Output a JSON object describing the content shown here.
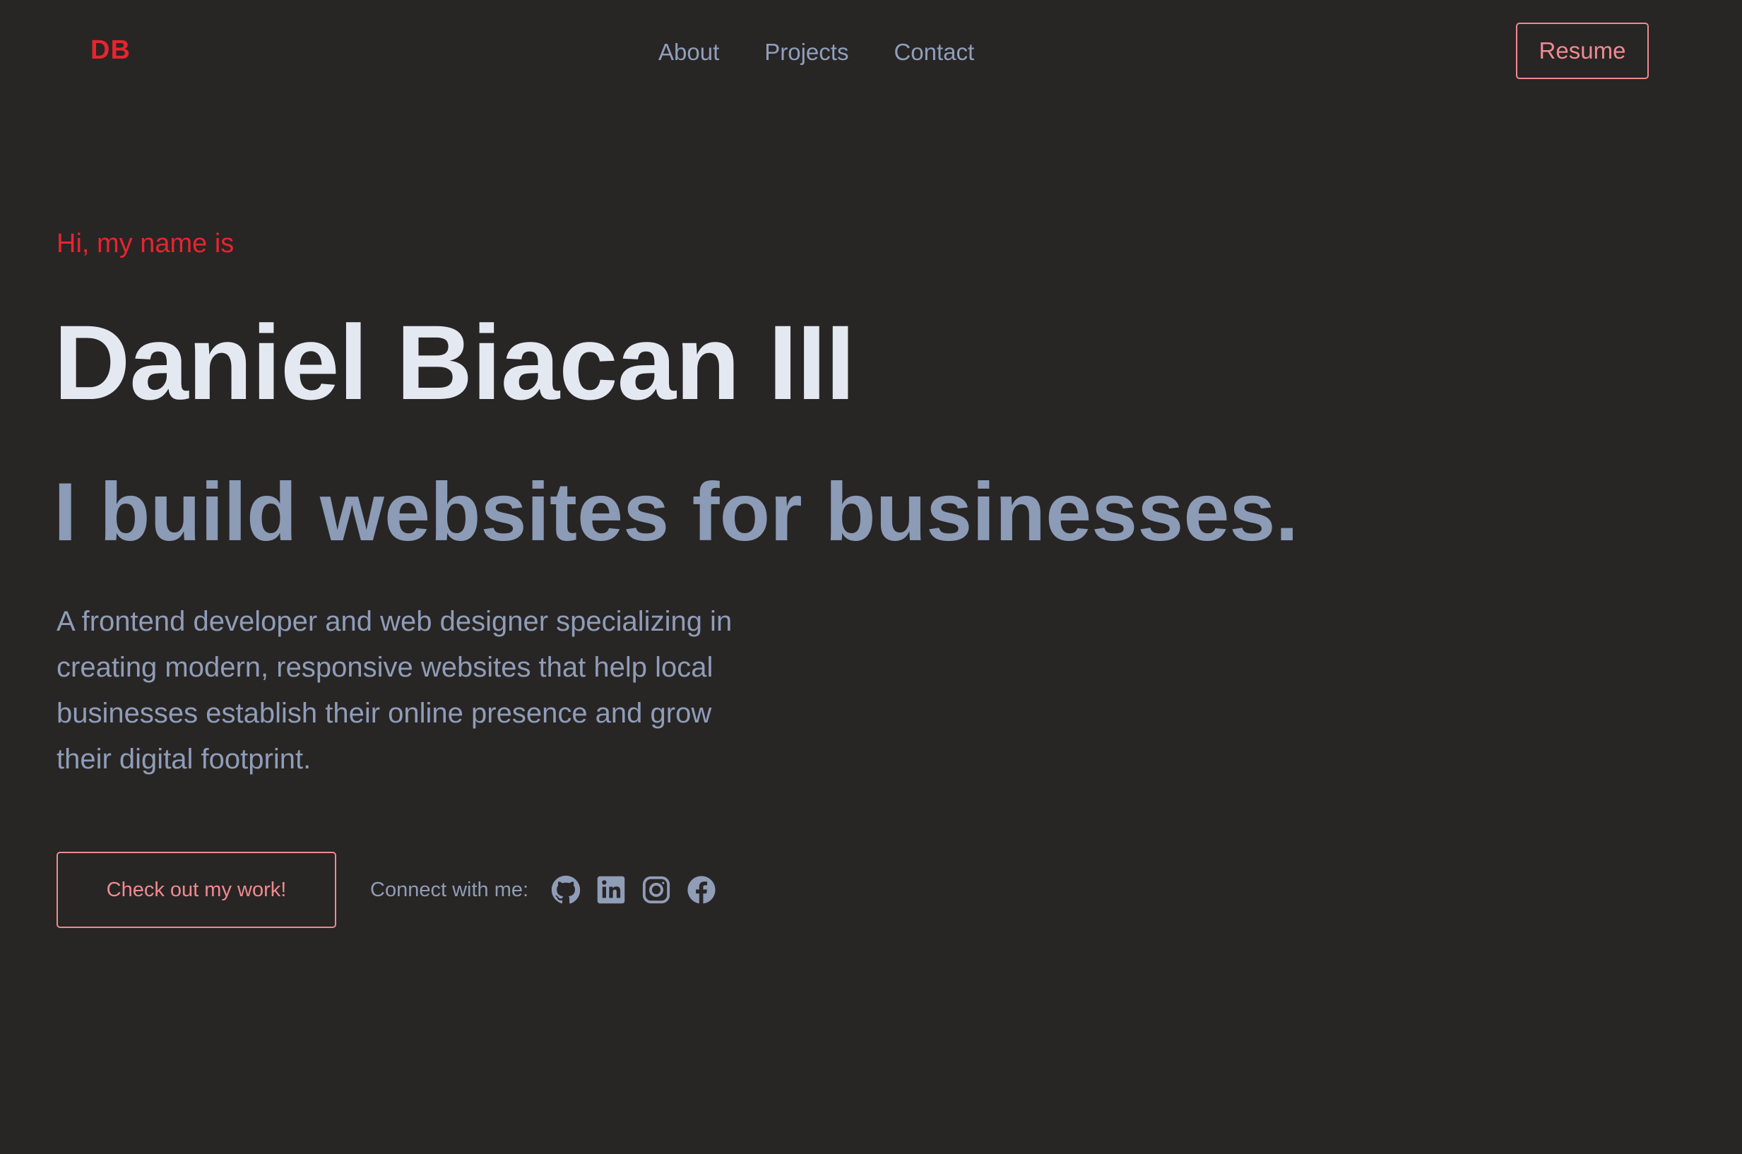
{
  "nav": {
    "logo": "DB",
    "links": [
      {
        "label": "About"
      },
      {
        "label": "Projects"
      },
      {
        "label": "Contact"
      }
    ],
    "resume_label": "Resume"
  },
  "hero": {
    "greeting": "Hi, my name is",
    "name": "Daniel Biacan III",
    "tagline": "I build websites for businesses.",
    "description": "A frontend developer and web designer specializing in creating modern, responsive websites that help local businesses establish their online presence and grow their digital footprint.",
    "cta_label": "Check out my work!",
    "connect_label": "Connect with me:",
    "socials": [
      {
        "icon": "github-icon"
      },
      {
        "icon": "linkedin-icon"
      },
      {
        "icon": "instagram-icon"
      },
      {
        "icon": "facebook-icon"
      }
    ]
  },
  "colors": {
    "background": "#282525",
    "accent": "#e5252f",
    "accent_soft": "#f08a8f",
    "heading": "#e4e9f1",
    "muted": "#8c9bb6"
  }
}
